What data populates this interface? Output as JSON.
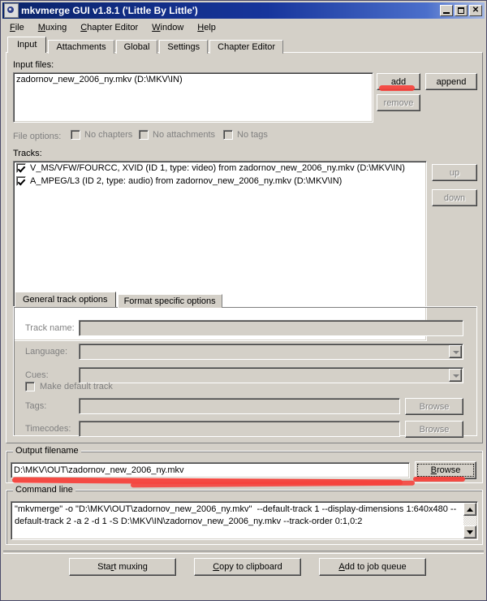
{
  "window": {
    "title": "mkvmerge GUI v1.8.1 ('Little By Little')",
    "icon": "app-icon",
    "minimize_label": "_",
    "maximize_label": "□",
    "close_label": "✕"
  },
  "menubar": {
    "items": [
      {
        "label": "File",
        "accel": "F"
      },
      {
        "label": "Muxing",
        "accel": "M"
      },
      {
        "label": "Chapter Editor",
        "accel": "C"
      },
      {
        "label": "Window",
        "accel": "W"
      },
      {
        "label": "Help",
        "accel": "H"
      }
    ]
  },
  "tabs": {
    "active": "Input",
    "items": [
      {
        "label": "Input"
      },
      {
        "label": "Attachments"
      },
      {
        "label": "Global"
      },
      {
        "label": "Settings"
      },
      {
        "label": "Chapter Editor"
      }
    ]
  },
  "input_tab": {
    "input_files_label": "Input files:",
    "input_files": [
      "zadornov_new_2006_ny.mkv (D:\\MKV\\IN)"
    ],
    "buttons": {
      "add": "add",
      "append": "append",
      "remove": "remove"
    },
    "file_options": {
      "label": "File options:",
      "checkboxes": [
        {
          "label": "No chapters",
          "checked": false
        },
        {
          "label": "No attachments",
          "checked": false
        },
        {
          "label": "No tags",
          "checked": false
        }
      ]
    },
    "tracks_label": "Tracks:",
    "tracks": [
      {
        "label": "V_MS/VFW/FOURCC, XVID (ID 1, type: video) from zadornov_new_2006_ny.mkv (D:\\MKV\\IN)",
        "checked": true
      },
      {
        "label": "A_MPEG/L3 (ID 2, type: audio) from zadornov_new_2006_ny.mkv (D:\\MKV\\IN)",
        "checked": true
      }
    ],
    "track_move": {
      "up": "up",
      "down": "down"
    },
    "track_option_tabs": {
      "active": "General track options",
      "items": [
        {
          "label": "General track options"
        },
        {
          "label": "Format specific options"
        }
      ]
    },
    "general_track_options": {
      "track_name": {
        "label": "Track name:",
        "value": ""
      },
      "language": {
        "label": "Language:",
        "value": ""
      },
      "cues": {
        "label": "Cues:",
        "value": ""
      },
      "make_default_track": {
        "label": "Make default track",
        "checked": false
      },
      "tags": {
        "label": "Tags:",
        "value": "",
        "browse": "Browse"
      },
      "timecodes": {
        "label": "Timecodes:",
        "value": "",
        "browse": "Browse"
      }
    }
  },
  "output": {
    "group_title": "Output filename",
    "value": "D:\\MKV\\OUT\\zadornov_new_2006_ny.mkv",
    "browse_label": "Browse",
    "browse_accel": "B"
  },
  "command_line": {
    "group_title": "Command line",
    "text": "\"mkvmerge\" -o \"D:\\MKV\\OUT\\zadornov_new_2006_ny.mkv\"  --default-track 1 --display-dimensions 1:640x480 --default-track 2 -a 2 -d 1 -S D:\\MKV\\IN\\zadornov_new_2006_ny.mkv --track-order 0:1,0:2"
  },
  "bottom_buttons": [
    {
      "label": "Start muxing",
      "accel": "r"
    },
    {
      "label": "Copy to clipboard",
      "accel": "C"
    },
    {
      "label": "Add to job queue",
      "accel": "A"
    }
  ],
  "colors": {
    "face": "#d4d0c8",
    "title_start": "#0a246a",
    "title_end": "#a6b9e4",
    "marker_red": "#f5423c",
    "disabled_text": "#808080"
  }
}
